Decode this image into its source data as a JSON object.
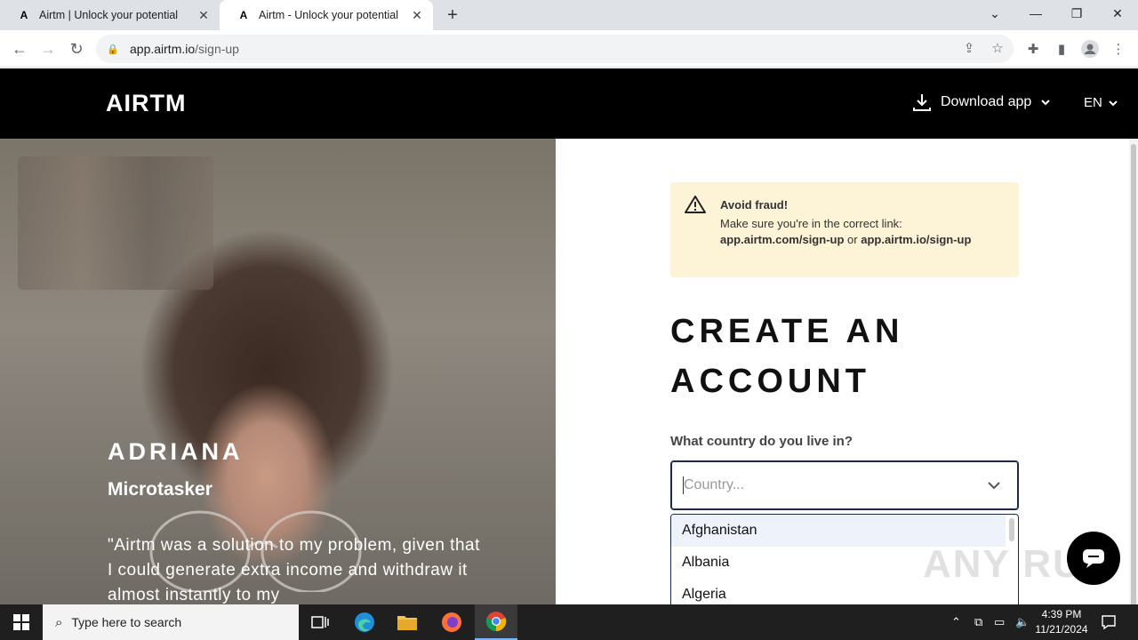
{
  "browser": {
    "tabs": [
      {
        "title": "Airtm | Unlock your potential",
        "active": false
      },
      {
        "title": "Airtm - Unlock your potential",
        "active": true
      }
    ],
    "url_host": "app.airtm.io",
    "url_path": "/sign-up"
  },
  "header": {
    "logo": "AIRTM",
    "download_label": "Download app",
    "language": "EN"
  },
  "hero": {
    "name": "ADRIANA",
    "role": "Microtasker",
    "quote": "\"Airtm was a solution to my problem, given that I could generate extra income and withdraw it almost instantly to my"
  },
  "fraud_notice": {
    "title": "Avoid fraud!",
    "text": "Make sure you're in the correct link:",
    "link1": "app.airtm.com/sign-up",
    "or": "or",
    "link2": "app.airtm.io/sign-up"
  },
  "form": {
    "title_line1": "CREATE AN",
    "title_line2": "ACCOUNT",
    "country_label": "What country do you live in?",
    "country_placeholder": "Country...",
    "country_options": [
      "Afghanistan",
      "Albania",
      "Algeria"
    ],
    "highlighted_option": "Afghanistan"
  },
  "watermark": "ANY RUN",
  "taskbar": {
    "search_placeholder": "Type here to search",
    "time": "4:39 PM",
    "date": "11/21/2024"
  },
  "colors": {
    "header_bg": "#000000",
    "notice_bg": "#fdf3d7",
    "select_border": "#1b2a4a",
    "highlight_option": "#eef2fb"
  }
}
